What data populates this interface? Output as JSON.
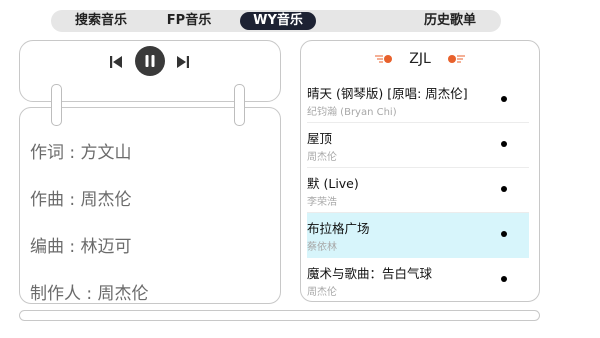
{
  "tabs": [
    {
      "label": "搜索音乐",
      "active": false
    },
    {
      "label": "FP音乐",
      "active": false
    },
    {
      "label": "WY音乐",
      "active": true
    },
    {
      "label": "历史歌单",
      "active": false
    }
  ],
  "player": {
    "controls": [
      "previous-icon",
      "pause-icon",
      "next-icon"
    ]
  },
  "credits": {
    "lyricist": "作词 : 方文山",
    "composer": "作曲 : 周杰伦",
    "arranger": "编曲 : 林迈可",
    "producer": "制作人 : 周杰伦"
  },
  "playlist": {
    "title": "ZJL",
    "accent_color": "#e8612c",
    "songs": [
      {
        "title": "晴天 (钢琴版) [原唱: 周杰伦]",
        "artist": "纪钧瀚 (Bryan Chi)",
        "active": false
      },
      {
        "title": "屋顶",
        "artist": "周杰伦",
        "active": false
      },
      {
        "title": "默 (Live)",
        "artist": "李荣浩",
        "active": false
      },
      {
        "title": "布拉格广场",
        "artist": "蔡依林",
        "active": true
      },
      {
        "title": "魔术与歌曲：告白气球",
        "artist": "周杰伦",
        "active": false
      }
    ]
  },
  "progress": {
    "fraction": 0.0
  }
}
